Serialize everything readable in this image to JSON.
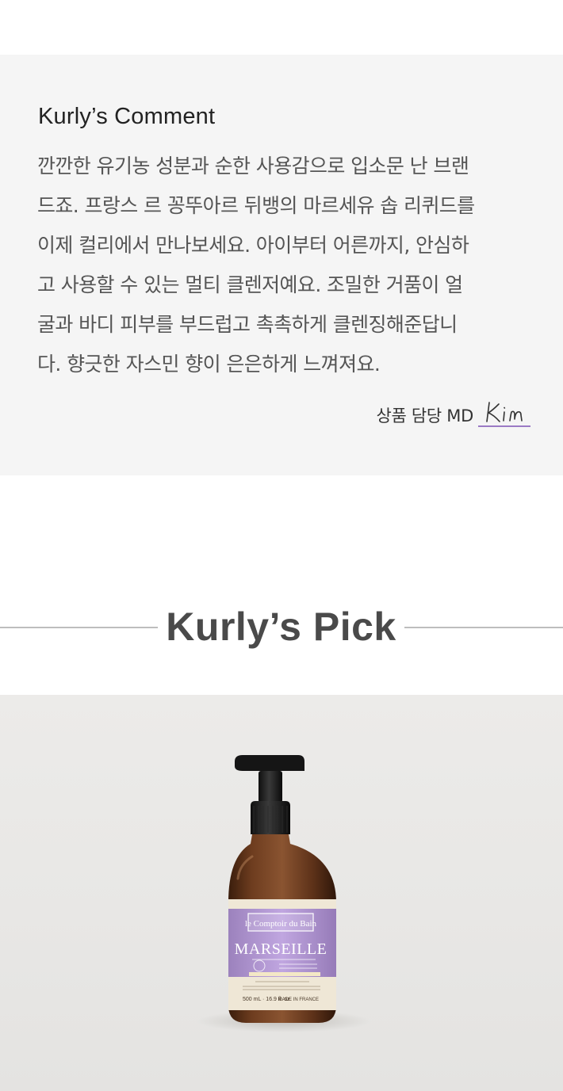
{
  "comment": {
    "title": "Kurly’s Comment",
    "lines": [
      "깐깐한 유기농 성분과 순한 사용감으로 입소문 난 브랜",
      "드죠. 프랑스 르 꽁뚜아르 뒤뱅의 마르세유 솝 리퀴드를",
      "이제 컬리에서 만나보세요. 아이부터 어른까지, 안심하",
      "고 사용할 수 있는 멀티 클렌저예요. 조밀한 거품이 얼",
      "굴과 바디 피부를 부드럽고 촉촉하게 클렌징해준답니",
      "다. 향긋한 자스민 향이 은은하게 느껴져요."
    ],
    "md_label": "상품 담당 MD",
    "md_signature": "Kim",
    "signature_color": "#9b7ac4"
  },
  "pick": {
    "title": "Kurly’s Pick"
  },
  "product": {
    "brand_label": "le Comptoir du Bain",
    "product_name": "MARSEILLE",
    "volume": "500 mL · 16.9 fl. oz.",
    "origin": "MADE IN FRANCE",
    "label_color": "#b79bd8",
    "bottle_color": "#6b3d22"
  }
}
